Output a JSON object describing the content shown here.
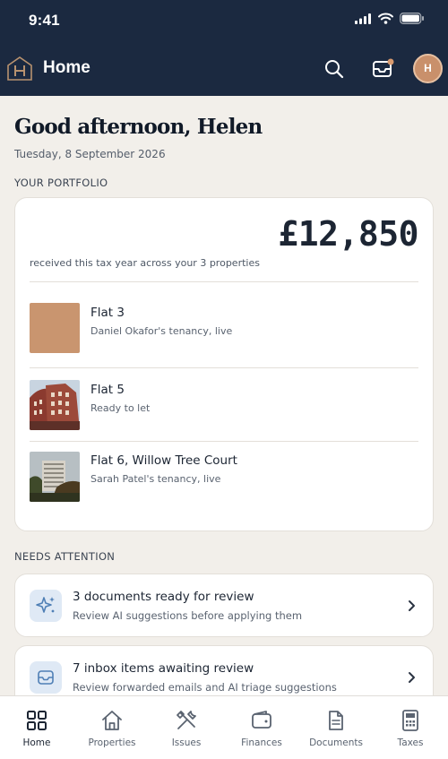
{
  "status_bar": {
    "time": "9:41"
  },
  "header": {
    "title": "Home",
    "icons": [
      "search-icon",
      "inbox-icon",
      "avatar"
    ],
    "avatar_initial": "H",
    "notification_dot_color": "#d89a6f"
  },
  "greeting": {
    "title": "Good afternoon, Helen",
    "date": "Tuesday, 8 September 2026"
  },
  "portfolio": {
    "section_label": "YOUR PORTFOLIO",
    "amount": "£12,850",
    "caption": "received this tax year across your 3 properties",
    "properties": [
      {
        "name": "Flat 3",
        "status": "Daniel Okafor's tenancy, live",
        "thumb": "solid-tan"
      },
      {
        "name": "Flat 5",
        "status": "Ready to let",
        "thumb": "photo-red-brick-building"
      },
      {
        "name": "Flat 6, Willow Tree Court",
        "status": "Sarah Patel's tenancy, live",
        "thumb": "photo-tower-block"
      }
    ]
  },
  "attention": {
    "section_label": "NEEDS ATTENTION",
    "items": [
      {
        "title": "3 documents ready for review",
        "subtitle": "Review AI suggestions before applying them",
        "icon": "sparkle-icon"
      },
      {
        "title": "7 inbox items awaiting review",
        "subtitle": "Review forwarded emails and AI triage suggestions",
        "icon": "inbox-icon"
      }
    ]
  },
  "bottom_nav": {
    "active": "Home",
    "tabs": [
      {
        "label": "Home",
        "icon": "grid-icon"
      },
      {
        "label": "Properties",
        "icon": "house-icon"
      },
      {
        "label": "Issues",
        "icon": "tools-icon"
      },
      {
        "label": "Finances",
        "icon": "wallet-icon"
      },
      {
        "label": "Documents",
        "icon": "document-icon"
      },
      {
        "label": "Taxes",
        "icon": "calculator-icon"
      }
    ]
  },
  "colors": {
    "header_bg": "#1b2940",
    "page_bg": "#f2efea",
    "avatar": "#c9906b",
    "accent_icon_bg": "#dfe9f5"
  }
}
